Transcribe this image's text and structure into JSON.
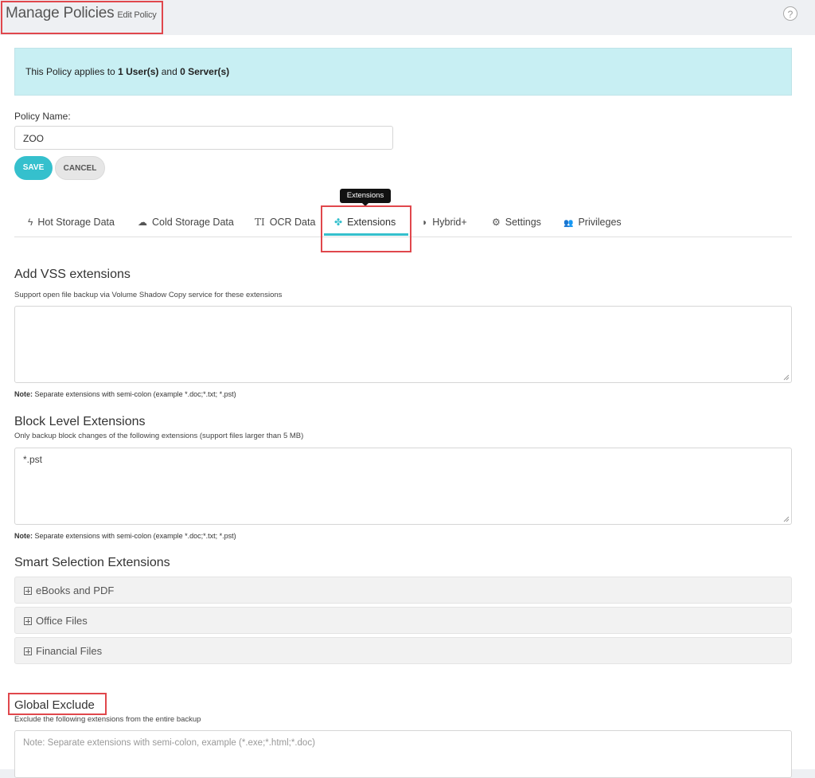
{
  "header": {
    "title": "Manage Policies",
    "subtitle": "Edit Policy",
    "help_icon": "?"
  },
  "banner": {
    "prefix": "This Policy applies to ",
    "users": "1 User(s)",
    "middle": " and ",
    "servers": "0 Server(s)"
  },
  "policy_name": {
    "label": "Policy Name:",
    "value": "ZOO"
  },
  "buttons": {
    "save": "SAVE",
    "cancel": "CANCEL"
  },
  "tooltip": "Extensions",
  "tabs": [
    {
      "label": "Hot Storage Data",
      "icon": "lightning-icon",
      "glyph": "ϟ"
    },
    {
      "label": "Cold Storage Data",
      "icon": "cloud-icon",
      "glyph": "☁"
    },
    {
      "label": "OCR Data",
      "icon": "text-icon",
      "glyph": "TI"
    },
    {
      "label": "Extensions",
      "icon": "puzzle-icon",
      "glyph": "✤",
      "active": true
    },
    {
      "label": "Hybrid+",
      "icon": "shield-icon",
      "glyph": "◗"
    },
    {
      "label": "Settings",
      "icon": "gears-icon",
      "glyph": "⚙"
    },
    {
      "label": "Privileges",
      "icon": "users-icon",
      "glyph": "👥"
    }
  ],
  "vss": {
    "title": "Add VSS extensions",
    "desc": "Support open file backup via Volume Shadow Copy service for these extensions",
    "value": "",
    "note_label": "Note:",
    "note_text": " Separate extensions with semi-colon (example *.doc;*.txt; *.pst)"
  },
  "block": {
    "title": "Block Level Extensions",
    "desc": "Only backup block changes of the following extensions (support files larger than 5 MB)",
    "value": "*.pst",
    "note_label": "Note:",
    "note_text": " Separate extensions with semi-colon (example *.doc;*.txt; *.pst)"
  },
  "smart": {
    "title": "Smart Selection Extensions",
    "items": [
      "eBooks and PDF",
      "Office Files",
      "Financial Files"
    ]
  },
  "global_exclude": {
    "title": "Global Exclude",
    "desc": "Exclude the following extensions from the entire backup",
    "placeholder": "Note: Separate extensions with semi-colon, example (*.exe;*.html;*.doc)"
  },
  "colors": {
    "accent": "#35c0cd",
    "banner_bg": "#c8eff3",
    "highlight": "#e0474c"
  }
}
